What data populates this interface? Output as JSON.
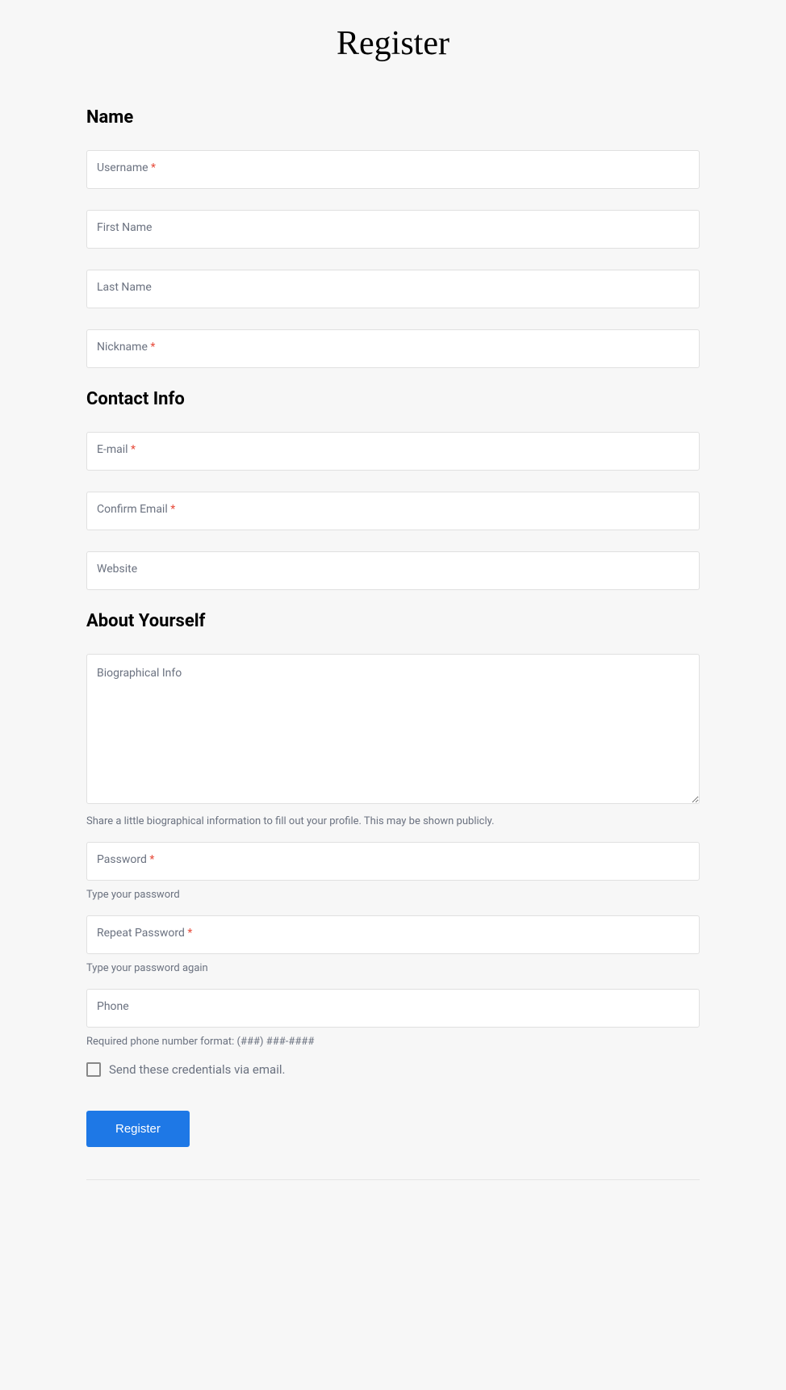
{
  "page": {
    "title": "Register"
  },
  "sections": {
    "name": {
      "heading": "Name",
      "fields": {
        "username": {
          "label": "Username",
          "required": true
        },
        "first_name": {
          "label": "First Name",
          "required": false
        },
        "last_name": {
          "label": "Last Name",
          "required": false
        },
        "nickname": {
          "label": "Nickname",
          "required": true
        }
      }
    },
    "contact": {
      "heading": "Contact Info",
      "fields": {
        "email": {
          "label": "E-mail",
          "required": true
        },
        "confirm_email": {
          "label": "Confirm Email",
          "required": true
        },
        "website": {
          "label": "Website",
          "required": false
        }
      }
    },
    "about": {
      "heading": "About Yourself",
      "fields": {
        "bio": {
          "label": "Biographical Info",
          "help": "Share a little biographical information to fill out your profile. This may be shown publicly."
        },
        "password": {
          "label": "Password",
          "required": true,
          "help": "Type your password"
        },
        "repeat_password": {
          "label": "Repeat Password",
          "required": true,
          "help": "Type your password again"
        },
        "phone": {
          "label": "Phone",
          "help": "Required phone number format: (###) ###-####"
        }
      }
    }
  },
  "consent": {
    "send_credentials_label": "Send these credentials via email."
  },
  "actions": {
    "submit_label": "Register"
  },
  "symbols": {
    "required": "*"
  }
}
